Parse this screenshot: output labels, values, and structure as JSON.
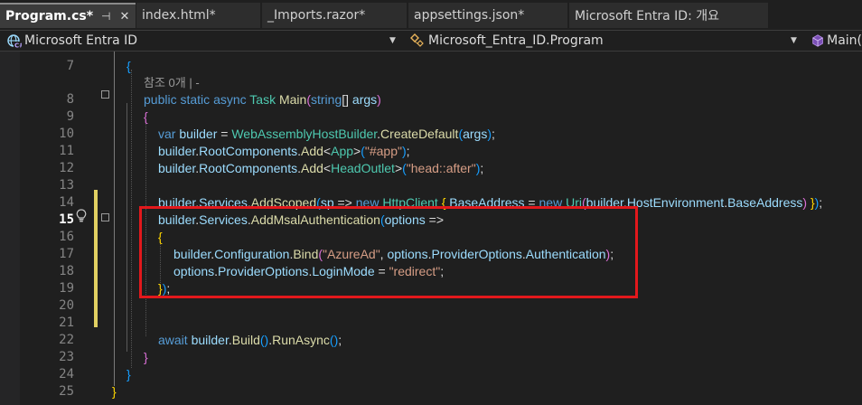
{
  "tabs": [
    {
      "label": "Program.cs*",
      "active": true,
      "pin": "⊣",
      "close": "✕"
    },
    {
      "label": "index.html*",
      "active": false
    },
    {
      "label": "_Imports.razor*",
      "active": false
    },
    {
      "label": "appsettings.json*",
      "active": false
    },
    {
      "label": "Microsoft Entra ID: 개요",
      "active": false
    }
  ],
  "navbar": {
    "project": "Microsoft Entra ID",
    "type": "Microsoft_Entra_ID.Program",
    "member": "Main("
  },
  "codelens": "참조 0개 | -",
  "lines": [
    {
      "num": "7"
    },
    {
      "num": "8"
    },
    {
      "num": "9"
    },
    {
      "num": "10"
    },
    {
      "num": "11"
    },
    {
      "num": "12"
    },
    {
      "num": "13"
    },
    {
      "num": "14"
    },
    {
      "num": "15"
    },
    {
      "num": "16"
    },
    {
      "num": "17"
    },
    {
      "num": "18"
    },
    {
      "num": "19"
    },
    {
      "num": "20"
    },
    {
      "num": "21"
    },
    {
      "num": "22"
    },
    {
      "num": "23"
    },
    {
      "num": "24"
    },
    {
      "num": "25"
    }
  ],
  "code": {
    "l7": {
      "brace": "{"
    },
    "l8": {
      "kw1": "public",
      "kw2": "static",
      "kw3": "async",
      "type": "Task",
      "method": "Main",
      "paren_open": "(",
      "kw4": "string",
      "rest": "[] ",
      "param": "args",
      "paren_close": ")"
    },
    "l9": {
      "brace": "{"
    },
    "l10": {
      "kw": "var",
      "var": "builder",
      "op": " = ",
      "type": "WebAssemblyHostBuilder",
      "dot": ".",
      "method": "CreateDefault",
      "paren_open": "(",
      "arg": "args",
      "paren_close": ")",
      "end": ";"
    },
    "l11": {
      "var": "builder",
      "dot1": ".",
      "prop": "RootComponents",
      "dot2": ".",
      "method": "Add",
      "lt": "<",
      "type": "App",
      "gt": ">",
      "paren_open": "(",
      "str": "\"#app\"",
      "paren_close": ")",
      "end": ";"
    },
    "l12": {
      "var": "builder",
      "dot1": ".",
      "prop": "RootComponents",
      "dot2": ".",
      "method": "Add",
      "lt": "<",
      "type": "HeadOutlet",
      "gt": ">",
      "paren_open": "(",
      "str": "\"head::after\"",
      "paren_close": ")",
      "end": ";"
    },
    "l14": {
      "var": "builder",
      "dot1": ".",
      "prop": "Services",
      "dot2": ".",
      "method": "AddScoped",
      "paren_open": "(",
      "param": "sp",
      "arrow": " => ",
      "kw": "new",
      "sp1": " ",
      "type1": "HttpClient",
      "sp2": " ",
      "brace_open": "{",
      "sp3": " ",
      "prop2": "BaseAddress",
      "eq": " = ",
      "kw2": "new",
      "sp4": " ",
      "type2": "Uri",
      "paren2_open": "(",
      "var2": "builder",
      "dot3": ".",
      "prop3": "HostEnvironment",
      "dot4": ".",
      "prop4": "BaseAddress",
      "paren2_close": ")",
      "sp5": " ",
      "brace_close": "}",
      "paren_close": ")",
      "end": ";"
    },
    "l15": {
      "var": "builder",
      "dot1": ".",
      "prop": "Services",
      "dot2": ".",
      "method": "AddMsalAuthentication",
      "paren_open": "(",
      "param": "options",
      "arrow": " =>"
    },
    "l16": {
      "brace": "{"
    },
    "l17": {
      "var": "builder",
      "dot1": ".",
      "prop": "Configuration",
      "dot2": ".",
      "method": "Bind",
      "paren_open": "(",
      "str": "\"AzureAd\"",
      "comma": ", ",
      "var2": "options",
      "dot3": ".",
      "prop2": "ProviderOptions",
      "dot4": ".",
      "prop3": "Authentication",
      "paren_close": ")",
      "end": ";"
    },
    "l18": {
      "var": "options",
      "dot1": ".",
      "prop": "ProviderOptions",
      "dot2": ".",
      "prop2": "LoginMode",
      "eq": " = ",
      "str": "\"redirect\"",
      "end": ";"
    },
    "l19": {
      "brace": "}",
      "paren": ")",
      "end": ";"
    },
    "l22": {
      "kw": "await",
      "sp": " ",
      "var": "builder",
      "dot1": ".",
      "method1": "Build",
      "parens1": "()",
      "dot2": ".",
      "method2": "RunAsync",
      "parens2": "()",
      "end": ";"
    },
    "l23": {
      "brace": "}"
    },
    "l24": {
      "brace": "}"
    },
    "l25": {
      "brace": "}"
    }
  },
  "colors": {
    "keyword": "#569cd6",
    "type": "#4ec9b0",
    "method": "#dcdcaa",
    "variable": "#9cdcfe",
    "string": "#d69d85",
    "highlight_box": "#e2181c",
    "change_bar": "#e1d062"
  },
  "icons": [
    "csharp-project-icon",
    "class-icon",
    "method-cube-icon",
    "lightbulb-icon"
  ]
}
